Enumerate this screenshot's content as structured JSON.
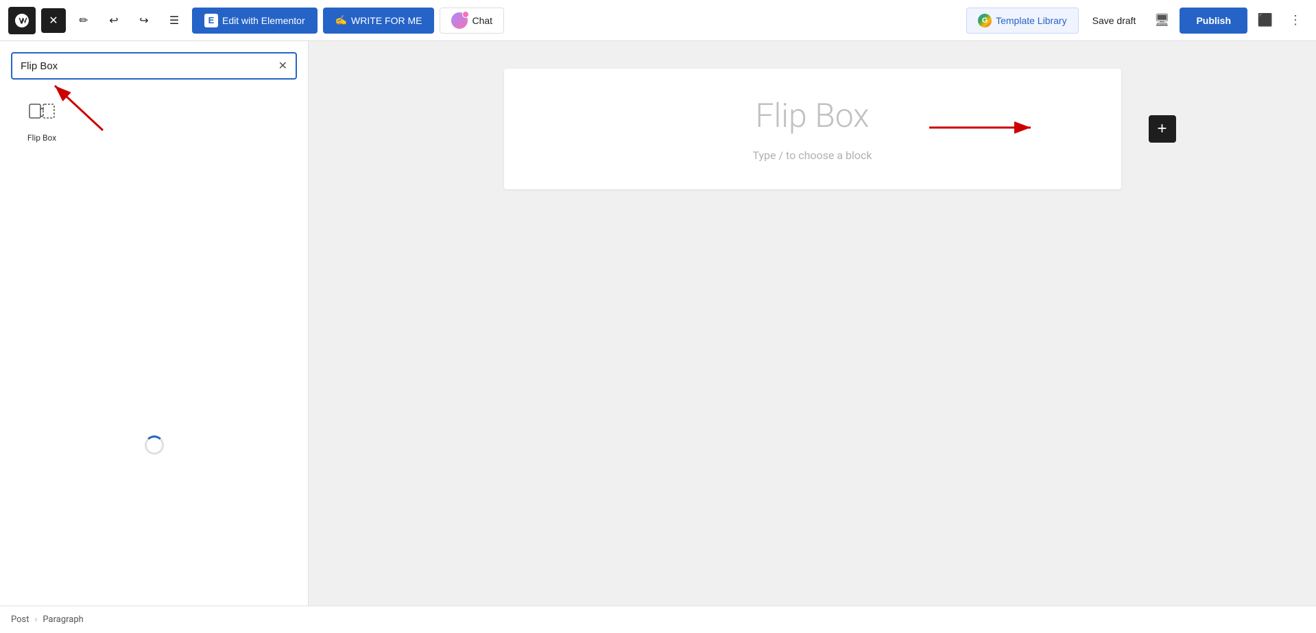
{
  "toolbar": {
    "close_label": "✕",
    "edit_elementor_label": "Edit with Elementor",
    "write_for_me_label": "WRITE FOR ME",
    "chat_label": "Chat",
    "template_library_label": "Template Library",
    "save_draft_label": "Save draft",
    "publish_label": "Publish",
    "elementor_icon": "E",
    "g_icon": "G"
  },
  "sidebar": {
    "search_placeholder": "Flip Box",
    "search_value": "Flip Box"
  },
  "widget": {
    "label": "Flip Box"
  },
  "editor": {
    "block_title": "Flip Box",
    "block_placeholder": "Type / to choose a block"
  },
  "bottom_bar": {
    "post_label": "Post",
    "separator": "›",
    "paragraph_label": "Paragraph"
  },
  "icons": {
    "undo": "↩",
    "redo": "↪",
    "menu": "☰",
    "monitor": "⬜",
    "more": "⋮"
  }
}
